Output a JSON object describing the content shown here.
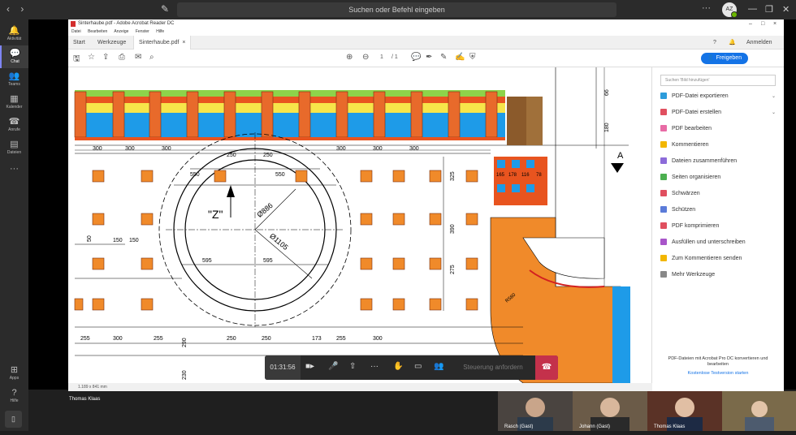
{
  "teams": {
    "search_placeholder": "Suchen oder Befehl eingeben",
    "nav_back": "‹",
    "nav_forward": "›",
    "more": "···",
    "avatar_initials": "AZ",
    "rail": [
      {
        "icon": "bell-icon",
        "glyph": "🔔",
        "label": "Aktivität"
      },
      {
        "icon": "chat-icon",
        "glyph": "💬",
        "label": "Chat",
        "active": true
      },
      {
        "icon": "teams-icon",
        "glyph": "👥",
        "label": "Teams"
      },
      {
        "icon": "calendar-icon",
        "glyph": "▦",
        "label": "Kalender"
      },
      {
        "icon": "phone-icon",
        "glyph": "☎",
        "label": "Anrufe"
      },
      {
        "icon": "files-icon",
        "glyph": "▤",
        "label": "Dateien"
      },
      {
        "icon": "more-icon",
        "glyph": "···",
        "label": ""
      }
    ],
    "rail_bottom": [
      {
        "icon": "apps-icon",
        "glyph": "⊞",
        "label": "Apps"
      },
      {
        "icon": "help-icon",
        "glyph": "?",
        "label": "Hilfe"
      }
    ],
    "sharer": "Thomas Klaas"
  },
  "reader": {
    "title": "Sinterhaube.pdf - Adobe Acrobat Reader DC",
    "menu": [
      "Datei",
      "Bearbeiten",
      "Anzeige",
      "Fenster",
      "Hilfe"
    ],
    "tabs": [
      "Start",
      "Werkzeuge",
      "Sinterhaube.pdf"
    ],
    "signin": "Anmelden",
    "page_current": "1",
    "page_total": "/ 1",
    "share_button": "Freigeben",
    "panel_search": "Suchen 'Bild hinzufügen'",
    "panel_items": [
      {
        "label": "PDF-Datei exportieren",
        "color": "#2d9cdb",
        "chev": true
      },
      {
        "label": "PDF-Datei erstellen",
        "color": "#e04f5f",
        "chev": true
      },
      {
        "label": "PDF bearbeiten",
        "color": "#e86ba5",
        "chev": false
      },
      {
        "label": "Kommentieren",
        "color": "#f2b600",
        "chev": false
      },
      {
        "label": "Dateien zusammenführen",
        "color": "#8c6bd9",
        "chev": false
      },
      {
        "label": "Seiten organisieren",
        "color": "#4caf50",
        "chev": false
      },
      {
        "label": "Schwärzen",
        "color": "#e04f5f",
        "chev": false
      },
      {
        "label": "Schützen",
        "color": "#5b7bd9",
        "chev": false
      },
      {
        "label": "PDF komprimieren",
        "color": "#e04f5f",
        "chev": false
      },
      {
        "label": "Ausfüllen und unterschreiben",
        "color": "#a855c9",
        "chev": false
      },
      {
        "label": "Zum Kommentieren senden",
        "color": "#f2b600",
        "chev": false
      },
      {
        "label": "Mehr Werkzeuge",
        "color": "#888888",
        "chev": false
      }
    ],
    "panel_footer": "PDF-Dateien mit Acrobat Pro DC konvertieren und bearbeiten",
    "panel_footer_link": "Kostenlose Testversion starten",
    "status_size": "1.189 x 841 mm"
  },
  "drawing": {
    "dims_top": [
      "300",
      "300",
      "300",
      "250",
      "250",
      "300",
      "300",
      "300"
    ],
    "dims_left": [
      "150",
      "150"
    ],
    "d_550a": "550",
    "d_550b": "550",
    "d_595a": "595",
    "d_595b": "595",
    "dia_886": "Ø886",
    "dia_1105": "Ø1105",
    "label_z": "\"Z\"",
    "v_325": "325",
    "v_390": "390",
    "v_275": "275",
    "v_66": "66",
    "v_180": "180",
    "section_a": "A",
    "blocks": [
      "165",
      "178",
      "116",
      "78"
    ],
    "bottom": [
      "255",
      "300",
      "255",
      "250",
      "250",
      "173",
      "255",
      "300"
    ],
    "v_290": "290",
    "v_230": "230",
    "v_50": "50",
    "r_label": "R580"
  },
  "call": {
    "timer": "01:31:56",
    "control_request": "Steuerung anfordern",
    "participants": [
      {
        "name": "Rasch (Gast)"
      },
      {
        "name": "Johann (Gast)"
      },
      {
        "name": "Thomas Klaas"
      },
      {
        "name": ""
      }
    ]
  }
}
